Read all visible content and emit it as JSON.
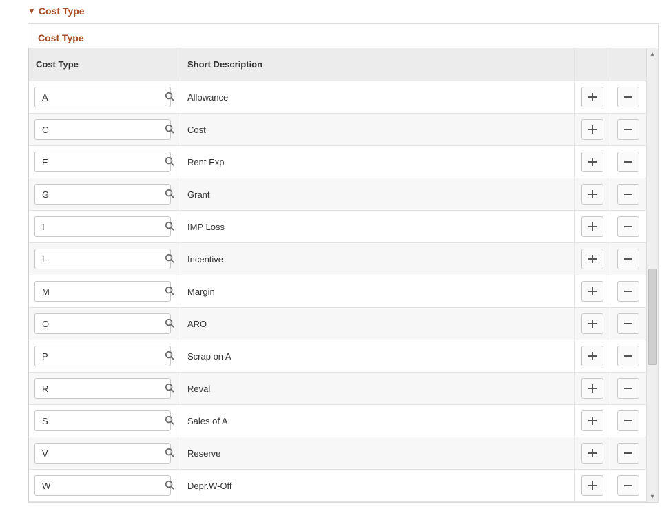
{
  "section": {
    "title": "Cost Type"
  },
  "grid": {
    "title": "Cost Type",
    "headers": {
      "code": "Cost Type",
      "desc": "Short Description"
    },
    "rows": [
      {
        "code": "A",
        "desc": "Allowance"
      },
      {
        "code": "C",
        "desc": "Cost"
      },
      {
        "code": "E",
        "desc": "Rent Exp"
      },
      {
        "code": "G",
        "desc": "Grant"
      },
      {
        "code": "I",
        "desc": "IMP Loss"
      },
      {
        "code": "L",
        "desc": "Incentive"
      },
      {
        "code": "M",
        "desc": "Margin"
      },
      {
        "code": "O",
        "desc": "ARO"
      },
      {
        "code": "P",
        "desc": "Scrap on A"
      },
      {
        "code": "R",
        "desc": "Reval"
      },
      {
        "code": "S",
        "desc": "Sales of A"
      },
      {
        "code": "V",
        "desc": "Reserve"
      },
      {
        "code": "W",
        "desc": "Depr.W-Off"
      }
    ]
  }
}
